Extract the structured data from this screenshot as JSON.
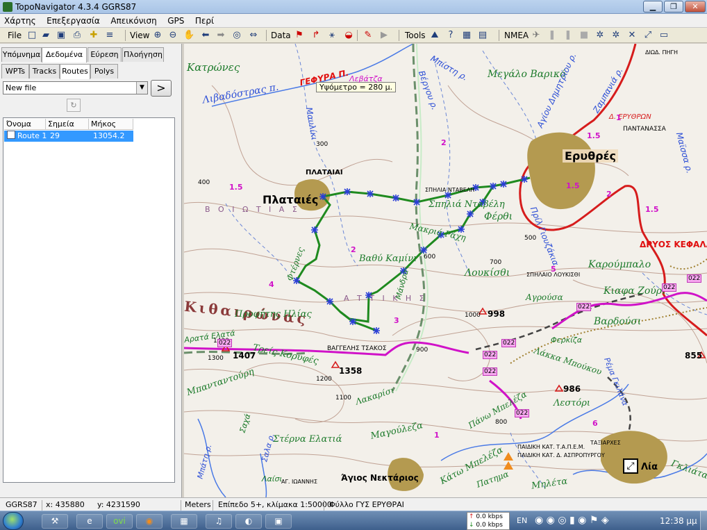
{
  "window": {
    "title": "TopoNavigator 4.3.4 GGRS87",
    "minimize": "▁",
    "maximize": "❐",
    "close": "✕"
  },
  "menu": [
    "Χάρτης",
    "Επεξεργασία",
    "Απεικόνιση",
    "GPS",
    "Περί"
  ],
  "toolbar": {
    "file_label": "File",
    "view_label": "View",
    "data_label": "Data",
    "tools_label": "Tools",
    "nmea_label": "NMEA"
  },
  "left_tabs_top": [
    "Υπόμνημα",
    "Δεδομένα",
    "Εύρεση",
    "Πλοήγηση"
  ],
  "left_tabs_sub": [
    "WPTs",
    "Tracks",
    "Routes",
    "Polys"
  ],
  "file_select": {
    "value": "New file"
  },
  "go_button": ">",
  "route_table": {
    "headers": [
      "Όνομα",
      "Σημεία",
      "Μήκος"
    ],
    "rows": [
      {
        "name": "Route 1",
        "points": "29",
        "length": "13054.2"
      }
    ]
  },
  "map": {
    "tooltip": "Υψόμετρο = 280 μ.",
    "labels": [
      "Κατρώνες",
      "Λιβαδόστρας π.",
      "ΓΕΦΥΡΑ Π.",
      "Λεβάτζα",
      "Βέργου ρ.",
      "Μπίστη ρ.",
      "Μεγάλο Βαρικό",
      "Αγίου Δημητρίου ρ.",
      "Ζαμπανιά ρ.",
      "Δ. ΕΡΥΘΡΩΝ",
      "ΠΑΝΤΑΝΑΣΣΑ",
      "Μαϊσσα ρ.",
      "ΔΙΩΔ. ΠΗΓΗ",
      "Μαυλίκι",
      "ΠΛΑΤΑΙΑΙ",
      "Πλαταιές",
      "ΣΠΗΛΙΑ ΝΤΑΒΕΛΗ",
      "Σπηλιά Νταβέλη",
      "Ερυθρές",
      "Φέρθι",
      "Πρίλ Γιουζάκια",
      "Μακριά Ράχη",
      "Φτέρνες",
      "Βαθύ Καμίνι",
      "Μάνδρα",
      "Λουκίσθι",
      "ΣΠΗΛΑΙΟ ΛΟΥΚΙΣΘΙ",
      "Καρούμπαλο",
      "Αγρούσα",
      "Κιαφα Ζούρι",
      "ΔΡΥΟΣ ΚΕΦΑΛΑ",
      "Κιθαιρώνας",
      "Προφήτης Ηλίας",
      "Λουκίσθι",
      "Βαρδούσι",
      "Φερκίζα",
      "Λάκκα Μπούκου",
      "Ρέμα Γκιλάνα",
      "Αρατά Ελατά",
      "Μπανταντούρη",
      "Τρείς Κορυφές",
      "ΒΑΓΓΕΛΗΣ ΤΣΑΚΟΣ",
      "Λακαρίσι",
      "Σαχά",
      "Στέρνα Ελατιά",
      "Μαγούλεζα",
      "Πάνω Μπελέζα",
      "Λεστόρι",
      "ΤΑΞΙΑΡΧΕΣ",
      "Άγιος Νεκτάριος",
      "ΑΓ. ΙΩΑΝΝΗΣ",
      "Κάτω Μπελέζα",
      "Πατημα",
      "Μηλέτα",
      "Λαίσι",
      "Γκλιάτα",
      "ΠΑΙΔΙΚΗ ΚΑΤ. Τ.Α.Π.Ε.Μ.",
      "ΠΑΙΔΙΚΗ ΚΑΤ. Δ. ΑΣΠΡΟΠΥΡΓΟΥ",
      "Λία",
      "Μπάτη ρ.",
      "Σαλα ρ.",
      "Β Ο Ι Ω Τ Ι Α Σ",
      "Α Τ Τ Ι Κ Η Σ"
    ],
    "elevations": [
      "1407",
      "1358",
      "998",
      "986",
      "855",
      "700",
      "500",
      "1000",
      "1400",
      "1300",
      "1200",
      "1100",
      "900",
      "800",
      "600",
      "400",
      "300"
    ],
    "road_codes": [
      "022",
      "022",
      "022",
      "022",
      "022",
      "022",
      "022",
      "022",
      "022"
    ],
    "slope_values": [
      "1.5",
      "1.5",
      "1.5",
      "1.5",
      "2",
      "2",
      "2",
      "3",
      "4",
      "5",
      "6",
      "1",
      "1"
    ]
  },
  "status": {
    "datum": "GGRS87",
    "x": "x: 435880",
    "y": "y: 4231590",
    "units": "Meters",
    "scale": "Επίπεδο 5+, κλίμακα 1:50000",
    "sheet": "Φύλλο ΓΥΣ ΕΡΥΘΡΑΙ"
  },
  "taskbar": {
    "language": "EN",
    "clock": "12:38 μμ",
    "net_up": "0.0 kbps",
    "net_down": "0.0 kbps"
  },
  "colors": {
    "route": "#1f8a1f",
    "waypoint": "#2b3fd6",
    "road_red": "#d61c1c",
    "road_magenta": "#d012c8",
    "contour": "#9c6a5a",
    "river": "#3d6fe0"
  }
}
